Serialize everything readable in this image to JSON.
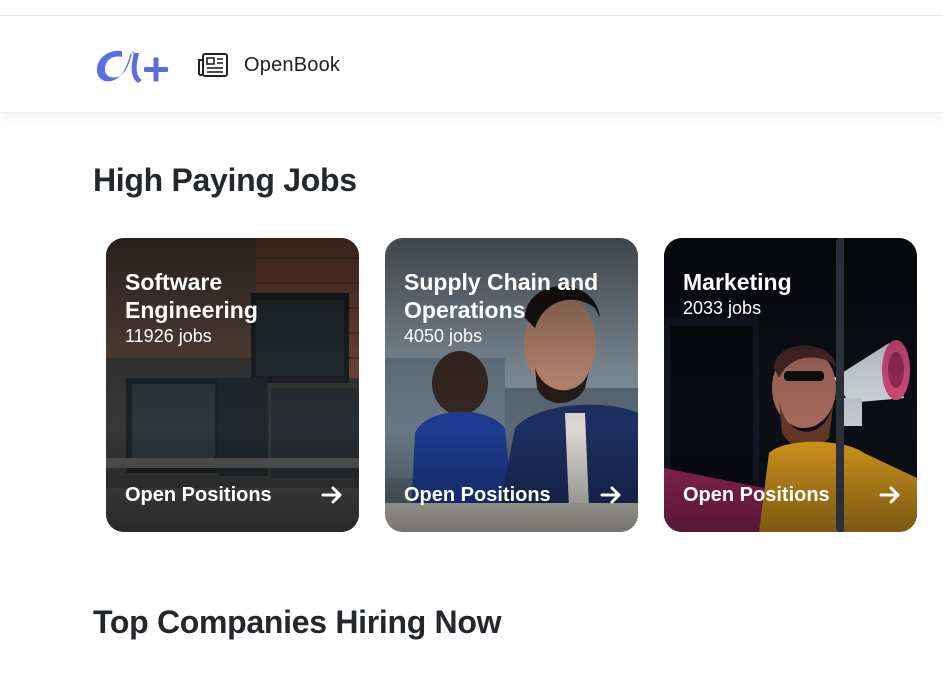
{
  "header": {
    "nav_label": "OpenBook",
    "logo_icon": "alpha-plus-logo",
    "nav_icon": "newspaper-icon"
  },
  "sections": {
    "jobs_title": "High Paying Jobs",
    "companies_title": "Top Companies Hiring Now"
  },
  "job_cards": [
    {
      "title": "Software Engineering",
      "count": "11926 jobs",
      "cta": "Open Positions",
      "icon": "arrow-right-icon"
    },
    {
      "title": "Supply Chain and Operations",
      "count": "4050 jobs",
      "cta": "Open Positions",
      "icon": "arrow-right-icon"
    },
    {
      "title": "Marketing",
      "count": "2033 jobs",
      "cta": "Open Positions",
      "icon": "arrow-right-icon"
    }
  ],
  "colors": {
    "brand": "#5b6ee1",
    "text": "#24282d",
    "card_text": "#ffffff"
  }
}
